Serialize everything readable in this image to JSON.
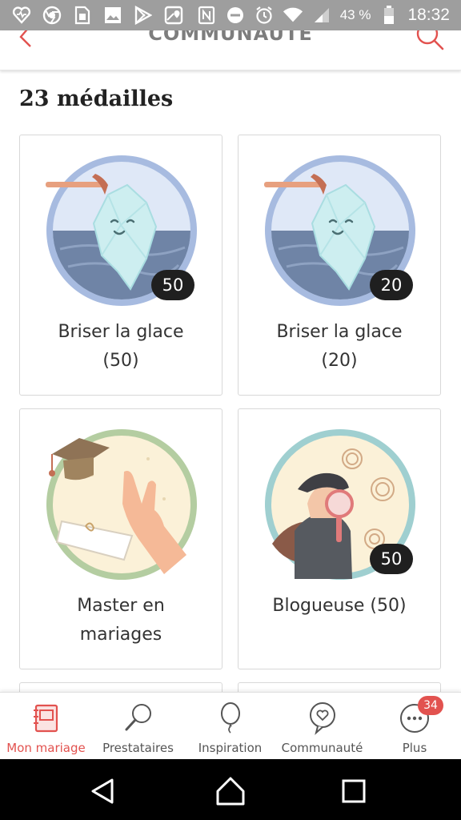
{
  "status_bar": {
    "left_icons": [
      "vitalstats-icon",
      "chrome-icon",
      "sim-icon",
      "gallery-icon",
      "play-store-icon",
      "maps-icon"
    ],
    "right_icons": [
      "nfc-icon",
      "do-not-disturb-icon",
      "alarm-icon",
      "wifi-icon",
      "signal-icon",
      "battery-icon"
    ],
    "battery_percent": "43 %",
    "time": "18:32"
  },
  "header": {
    "title": "COMMUNAUTÉ",
    "accent_color": "#e2524f"
  },
  "page": {
    "title": "23 médailles"
  },
  "medals": [
    {
      "label_line1": "Briser la glace",
      "label_line2": "(50)",
      "count": "50",
      "art": "iceberg-badge",
      "ring_color": "#a7bbe0"
    },
    {
      "label_line1": "Briser la glace",
      "label_line2": "(20)",
      "count": "20",
      "art": "iceberg-badge",
      "ring_color": "#a7bbe0"
    },
    {
      "label_line1": "Master en",
      "label_line2": "mariages",
      "count": "",
      "art": "graduation-badge",
      "ring_color": "#b4cda1"
    },
    {
      "label_line1": "Blogueuse (50)",
      "label_line2": "",
      "count": "50",
      "art": "detective-badge",
      "ring_color": "#9fcfd0"
    }
  ],
  "bottom_nav": [
    {
      "label": "Mon mariage",
      "icon": "notebook-icon",
      "active": true
    },
    {
      "label": "Prestataires",
      "icon": "magnifier-icon",
      "active": false
    },
    {
      "label": "Inspiration",
      "icon": "balloon-icon",
      "active": false
    },
    {
      "label": "Communauté",
      "icon": "chat-heart-icon",
      "active": false
    },
    {
      "label": "Plus",
      "icon": "more-icon",
      "active": false,
      "badge": "34"
    }
  ],
  "system_nav": [
    "back-triangle-icon",
    "home-circle-icon",
    "recents-square-icon"
  ]
}
